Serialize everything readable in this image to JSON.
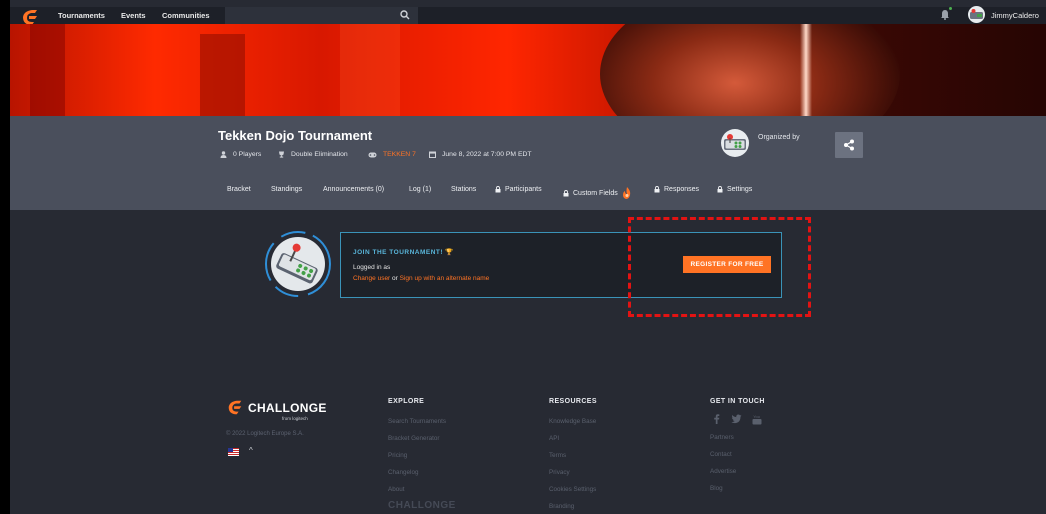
{
  "nav": {
    "links": [
      "Tournaments",
      "Events",
      "Communities"
    ],
    "username": "JimmyCaldero"
  },
  "tournament": {
    "title": "Tekken Dojo Tournament",
    "players": "0 Players",
    "format": "Double Elimination",
    "game": "TEKKEN 7",
    "date": "June 8, 2022 at 7:00 PM EDT",
    "organized_by": "Organized by"
  },
  "tabs": [
    {
      "label": "Bracket",
      "locked": false
    },
    {
      "label": "Standings",
      "locked": false
    },
    {
      "label": "Announcements (0)",
      "locked": false
    },
    {
      "label": "Log (1)",
      "locked": false
    },
    {
      "label": "Stations",
      "locked": false
    },
    {
      "label": "Participants",
      "locked": true
    },
    {
      "label": "Custom Fields",
      "locked": true
    },
    {
      "label": "Responses",
      "locked": true
    },
    {
      "label": "Settings",
      "locked": true
    }
  ],
  "join": {
    "title": "JOIN THE TOURNAMENT! 🏆",
    "logged_in": "Logged in as",
    "change_user": "Change user",
    "or": " or ",
    "alternate": "Sign up with an alternate name",
    "register": "REGISTER FOR FREE"
  },
  "footer": {
    "brand": "CHALLONGE",
    "brand_sub": "from logitech",
    "copyright": "© 2022 Logitech Europe S.A.",
    "explore": {
      "title": "EXPLORE",
      "links": [
        "Search Tournaments",
        "Bracket Generator",
        "Pricing",
        "Changelog",
        "About"
      ]
    },
    "resources": {
      "title": "RESOURCES",
      "links": [
        "Knowledge Base",
        "API",
        "Terms",
        "Privacy",
        "Cookies Settings",
        "Branding"
      ]
    },
    "contact": {
      "title": "GET IN TOUCH",
      "links": [
        "Partners",
        "Contact",
        "Advertise",
        "Blog"
      ]
    },
    "watermark": "CHALLONGE"
  },
  "colors": {
    "accent": "#ff7324",
    "highlight": "#e31313",
    "join_border": "#3a93b8"
  }
}
